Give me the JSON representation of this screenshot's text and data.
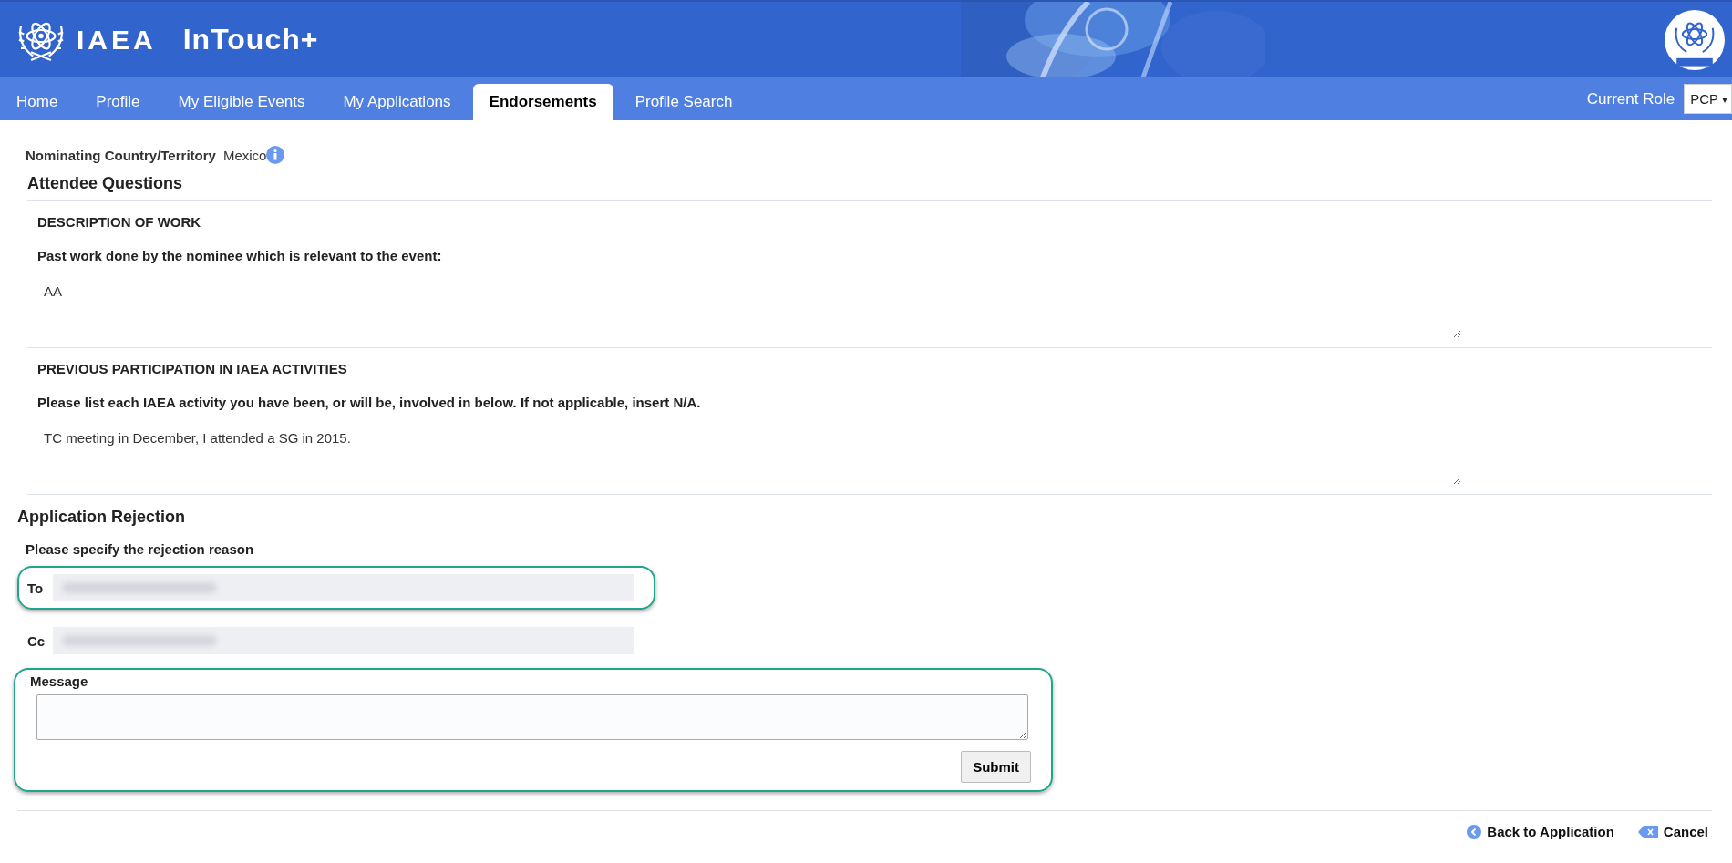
{
  "header": {
    "brand": "IAEA",
    "app_name": "InTouch+"
  },
  "nav": {
    "tabs": [
      {
        "label": "Home",
        "selected": false
      },
      {
        "label": "Profile",
        "selected": false
      },
      {
        "label": "My Eligible Events",
        "selected": false
      },
      {
        "label": "My Applications",
        "selected": false
      },
      {
        "label": "Endorsements",
        "selected": true
      },
      {
        "label": "Profile Search",
        "selected": false
      }
    ],
    "role_label": "Current Role",
    "role_value": "PCP",
    "role_caret": "▾"
  },
  "nominating": {
    "label": "Nominating Country/Territory",
    "value": "Mexico"
  },
  "attendee_questions": {
    "title": "Attendee Questions",
    "questions": [
      {
        "heading": "DESCRIPTION OF WORK",
        "prompt": "Past work done by the nominee which is relevant to the event:",
        "answer": "AA"
      },
      {
        "heading": "PREVIOUS PARTICIPATION IN IAEA ACTIVITIES",
        "prompt": "Please list each IAEA activity you have been, or will be, involved in below. If not applicable, insert N/A.",
        "answer": "TC meeting in December, I attended a SG in 2015."
      }
    ]
  },
  "rejection": {
    "title": "Application Rejection",
    "instruction": "Please specify the rejection reason",
    "recipients": [
      {
        "label": "To",
        "highlighted": true
      },
      {
        "label": "Cc",
        "highlighted": false
      }
    ],
    "message_label": "Message",
    "message_highlighted": true,
    "submit": "Submit"
  },
  "footer": {
    "actions": [
      {
        "kind": "back",
        "label": "Back to Application"
      },
      {
        "kind": "cancel",
        "label": "Cancel"
      }
    ]
  }
}
